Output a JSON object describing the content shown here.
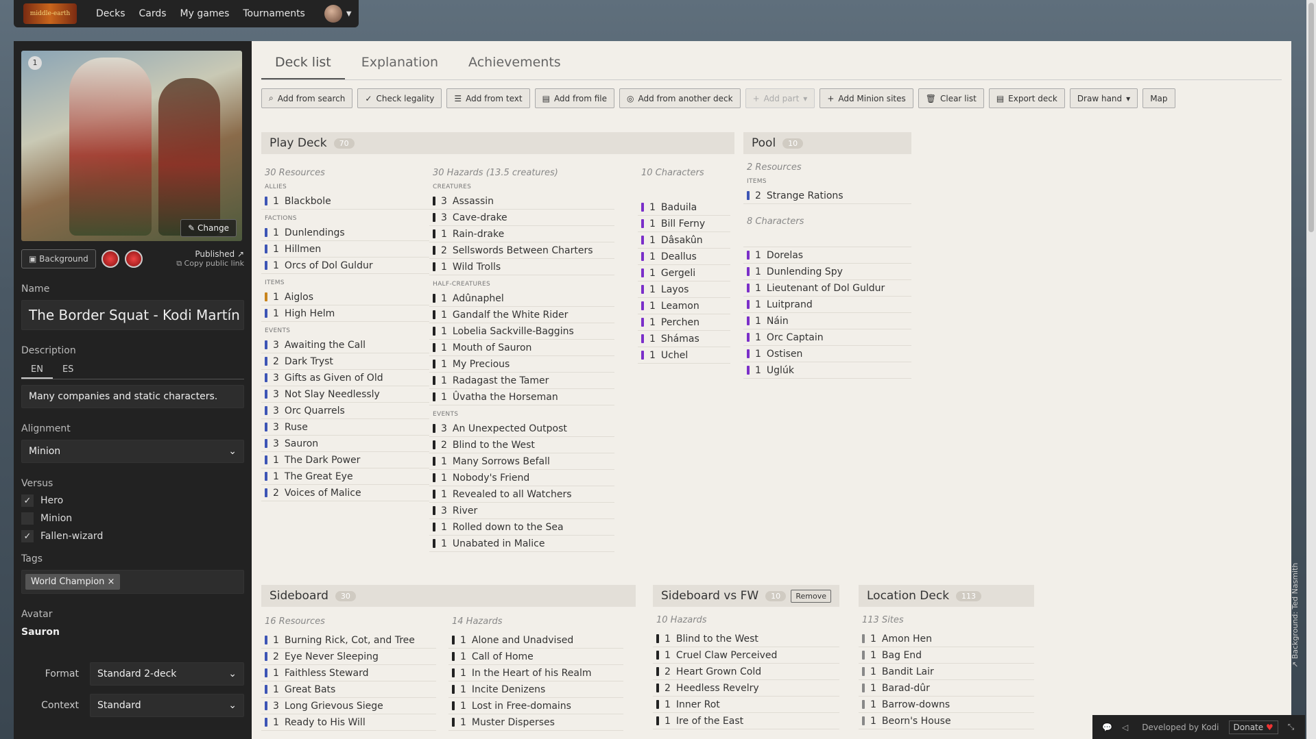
{
  "nav": {
    "logo": "middle-earth",
    "items": [
      "Decks",
      "Cards",
      "My games",
      "Tournaments"
    ]
  },
  "sidebar": {
    "card_badge": "1",
    "change_label": "Change",
    "background_label": "Background",
    "published": "Published",
    "copy_link": "Copy public link",
    "name_label": "Name",
    "name_value": "The Border Squat - Kodi Martín",
    "desc_label": "Description",
    "lang_tabs": [
      "EN",
      "ES"
    ],
    "desc_value": "Many companies and static characters.",
    "align_label": "Alignment",
    "align_value": "Minion",
    "versus_label": "Versus",
    "versus": [
      {
        "label": "Hero",
        "checked": true
      },
      {
        "label": "Minion",
        "checked": false
      },
      {
        "label": "Fallen-wizard",
        "checked": true
      }
    ],
    "tags_label": "Tags",
    "tag": "World Champion",
    "avatar_label": "Avatar",
    "avatar_value": "Sauron",
    "format_label": "Format",
    "format_value": "Standard 2-deck",
    "context_label": "Context",
    "context_value": "Standard"
  },
  "tabs": [
    "Deck list",
    "Explanation",
    "Achievements"
  ],
  "toolbar": [
    {
      "label": "Add from search",
      "icon": "search-icon"
    },
    {
      "label": "Check legality",
      "icon": "check-circle-icon"
    },
    {
      "label": "Add from text",
      "icon": "list-icon"
    },
    {
      "label": "Add from file",
      "icon": "file-icon"
    },
    {
      "label": "Add from another deck",
      "icon": "eye-icon"
    },
    {
      "label": "Add part",
      "icon": "plus-icon",
      "disabled": true
    },
    {
      "label": "Add Minion sites",
      "icon": "plus-icon"
    },
    {
      "label": "Clear list",
      "icon": "trash-icon"
    },
    {
      "label": "Export deck",
      "icon": "file-icon"
    },
    {
      "label": "Draw hand",
      "icon": ""
    },
    {
      "label": "Map",
      "icon": ""
    }
  ],
  "colors": {
    "resource": "#3d55b5",
    "hazard": "#222222",
    "character": "#7b2fc9",
    "item_unique": "#c8841c",
    "site": "#888888"
  },
  "play": {
    "title": "Play Deck",
    "count": "70",
    "res_title": "30 Resources",
    "haz_title": "30 Hazards (13.5 creatures)",
    "char_title": "10 Characters",
    "allies_label": "ALLIES",
    "allies": [
      {
        "q": "1",
        "n": "Blackbole"
      }
    ],
    "factions_label": "FACTIONS",
    "factions": [
      {
        "q": "1",
        "n": "Dunlendings"
      },
      {
        "q": "1",
        "n": "Hillmen"
      },
      {
        "q": "1",
        "n": "Orcs of Dol Guldur"
      }
    ],
    "items_label": "ITEMS",
    "items": [
      {
        "q": "1",
        "n": "Aiglos",
        "c": "item_unique"
      },
      {
        "q": "1",
        "n": "High Helm"
      }
    ],
    "events_label": "EVENTS",
    "events": [
      {
        "q": "3",
        "n": "Awaiting the Call"
      },
      {
        "q": "2",
        "n": "Dark Tryst"
      },
      {
        "q": "3",
        "n": "Gifts as Given of Old"
      },
      {
        "q": "3",
        "n": "Not Slay Needlessly"
      },
      {
        "q": "3",
        "n": "Orc Quarrels"
      },
      {
        "q": "3",
        "n": "Ruse"
      },
      {
        "q": "3",
        "n": "Sauron"
      },
      {
        "q": "1",
        "n": "The Dark Power"
      },
      {
        "q": "1",
        "n": "The Great Eye"
      },
      {
        "q": "2",
        "n": "Voices of Malice"
      }
    ],
    "creatures_label": "CREATURES",
    "creatures": [
      {
        "q": "3",
        "n": "Assassin"
      },
      {
        "q": "3",
        "n": "Cave-drake"
      },
      {
        "q": "1",
        "n": "Rain-drake"
      },
      {
        "q": "2",
        "n": "Sellswords Between Charters"
      },
      {
        "q": "1",
        "n": "Wild Trolls"
      }
    ],
    "half_label": "HALF-CREATURES",
    "half": [
      {
        "q": "1",
        "n": "Adûnaphel"
      },
      {
        "q": "1",
        "n": "Gandalf the White Rider"
      },
      {
        "q": "1",
        "n": "Lobelia Sackville-Baggins"
      },
      {
        "q": "1",
        "n": "Mouth of Sauron"
      },
      {
        "q": "1",
        "n": "My Precious"
      },
      {
        "q": "1",
        "n": "Radagast the Tamer"
      },
      {
        "q": "1",
        "n": "Ûvatha the Horseman"
      }
    ],
    "hevents_label": "EVENTS",
    "hevents": [
      {
        "q": "3",
        "n": "An Unexpected Outpost"
      },
      {
        "q": "2",
        "n": "Blind to the West"
      },
      {
        "q": "1",
        "n": "Many Sorrows Befall"
      },
      {
        "q": "1",
        "n": "Nobody's Friend"
      },
      {
        "q": "1",
        "n": "Revealed to all Watchers"
      },
      {
        "q": "3",
        "n": "River"
      },
      {
        "q": "1",
        "n": "Rolled down to the Sea"
      },
      {
        "q": "1",
        "n": "Unabated in Malice"
      }
    ],
    "characters": [
      {
        "q": "1",
        "n": "Baduila"
      },
      {
        "q": "1",
        "n": "Bill Ferny"
      },
      {
        "q": "1",
        "n": "Dâsakûn"
      },
      {
        "q": "1",
        "n": "Deallus"
      },
      {
        "q": "1",
        "n": "Gergeli"
      },
      {
        "q": "1",
        "n": "Layos"
      },
      {
        "q": "1",
        "n": "Leamon"
      },
      {
        "q": "1",
        "n": "Perchen"
      },
      {
        "q": "1",
        "n": "Shámas"
      },
      {
        "q": "1",
        "n": "Uchel"
      }
    ]
  },
  "pool": {
    "title": "Pool",
    "count": "10",
    "res_title": "2 Resources",
    "items_label": "ITEMS",
    "items": [
      {
        "q": "2",
        "n": "Strange Rations"
      }
    ],
    "char_title": "8 Characters",
    "characters": [
      {
        "q": "1",
        "n": "Dorelas"
      },
      {
        "q": "1",
        "n": "Dunlending Spy"
      },
      {
        "q": "1",
        "n": "Lieutenant of Dol Guldur"
      },
      {
        "q": "1",
        "n": "Luitprand"
      },
      {
        "q": "1",
        "n": "Náin"
      },
      {
        "q": "1",
        "n": "Orc Captain"
      },
      {
        "q": "1",
        "n": "Ostisen"
      },
      {
        "q": "1",
        "n": "Uglúk"
      }
    ]
  },
  "sideboard": {
    "title": "Sideboard",
    "count": "30",
    "res_title": "16 Resources",
    "haz_title": "14 Hazards",
    "resources": [
      {
        "q": "1",
        "n": "Burning Rick, Cot, and Tree"
      },
      {
        "q": "2",
        "n": "Eye Never Sleeping"
      },
      {
        "q": "1",
        "n": "Faithless Steward"
      },
      {
        "q": "1",
        "n": "Great Bats"
      },
      {
        "q": "3",
        "n": "Long Grievous Siege"
      },
      {
        "q": "1",
        "n": "Ready to His Will"
      }
    ],
    "hazards": [
      {
        "q": "1",
        "n": "Alone and Unadvised"
      },
      {
        "q": "1",
        "n": "Call of Home"
      },
      {
        "q": "1",
        "n": "In the Heart of his Realm"
      },
      {
        "q": "1",
        "n": "Incite Denizens"
      },
      {
        "q": "1",
        "n": "Lost in Free-domains"
      },
      {
        "q": "1",
        "n": "Muster Disperses"
      }
    ]
  },
  "sbfw": {
    "title": "Sideboard vs FW",
    "count": "10",
    "remove": "Remove",
    "haz_title": "10 Hazards",
    "hazards": [
      {
        "q": "1",
        "n": "Blind to the West"
      },
      {
        "q": "1",
        "n": "Cruel Claw Perceived"
      },
      {
        "q": "2",
        "n": "Heart Grown Cold"
      },
      {
        "q": "2",
        "n": "Heedless Revelry"
      },
      {
        "q": "1",
        "n": "Inner Rot"
      },
      {
        "q": "1",
        "n": "Ire of the East"
      }
    ]
  },
  "location": {
    "title": "Location Deck",
    "count": "113",
    "sites_title": "113 Sites",
    "sites": [
      {
        "q": "1",
        "n": "Amon Hen"
      },
      {
        "q": "1",
        "n": "Bag End"
      },
      {
        "q": "1",
        "n": "Bandit Lair"
      },
      {
        "q": "1",
        "n": "Barad-dûr"
      },
      {
        "q": "1",
        "n": "Barrow-downs"
      },
      {
        "q": "1",
        "n": "Beorn's House"
      }
    ]
  },
  "footer": {
    "developed": "Developed by Kodi",
    "donate": "Donate"
  },
  "bg_credit": "Background: Ted Nasmith"
}
